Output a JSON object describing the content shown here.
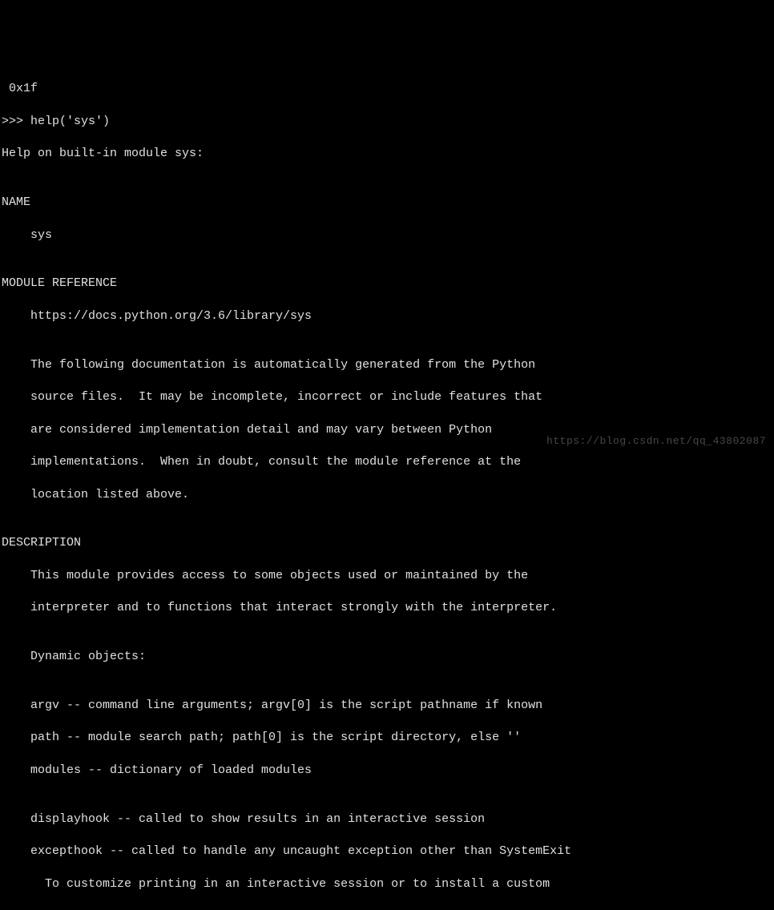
{
  "terminal": {
    "lines": [
      " 0x1f",
      ">>> help('sys')",
      "Help on built-in module sys:",
      "",
      "NAME",
      "    sys",
      "",
      "MODULE REFERENCE",
      "    https://docs.python.org/3.6/library/sys",
      "",
      "    The following documentation is automatically generated from the Python",
      "    source files.  It may be incomplete, incorrect or include features that",
      "    are considered implementation detail and may vary between Python",
      "    implementations.  When in doubt, consult the module reference at the",
      "    location listed above.",
      "",
      "DESCRIPTION",
      "    This module provides access to some objects used or maintained by the",
      "    interpreter and to functions that interact strongly with the interpreter.",
      "",
      "    Dynamic objects:",
      "",
      "    argv -- command line arguments; argv[0] is the script pathname if known",
      "    path -- module search path; path[0] is the script directory, else ''",
      "    modules -- dictionary of loaded modules",
      "",
      "    displayhook -- called to show results in an interactive session",
      "    excepthook -- called to handle any uncaught exception other than SystemExit",
      "      To customize printing in an interactive session or to install a custom"
    ]
  },
  "watermark": {
    "text": "https://blog.csdn.net/qq_43802087"
  }
}
